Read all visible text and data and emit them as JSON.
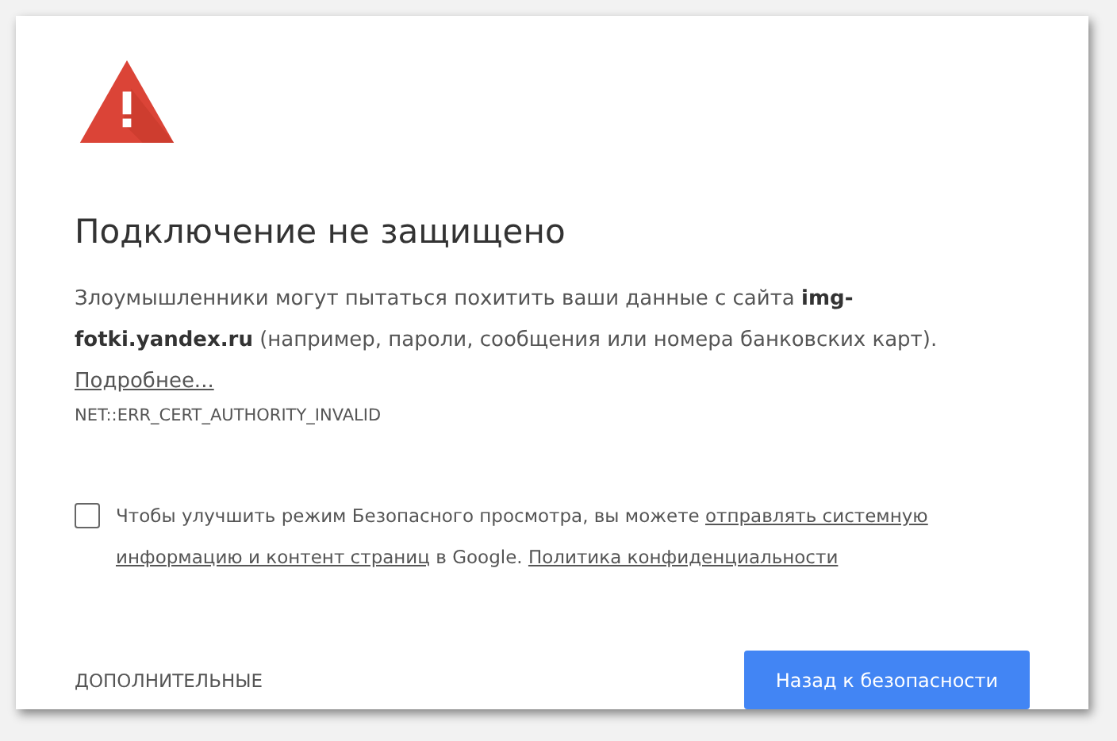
{
  "heading": "Подключение не защищено",
  "description": {
    "text": "Злоумышленники могут пытаться похитить ваши данные с сайта **img-fotki.yandex.ru** (например, пароли, сообщения или номера банковских карт).",
    "link": "Подробнее..."
  },
  "error_code": "NET::ERR_CERT_AUTHORITY_INVALID",
  "safe_browsing": {
    "checked": false,
    "parts": [
      {
        "kind": "text",
        "text": "Чтобы улучшить режим Безопасного просмотра, вы можете"
      },
      {
        "kind": "link",
        "text": "отправлять системную"
      },
      {
        "kind": "link",
        "text": "информацию и контент страниц"
      },
      {
        "kind": "text",
        "text": "в Google."
      },
      {
        "kind": "link",
        "text": "Политика конфиденциальности"
      }
    ]
  },
  "advanced_button": "ДОПОЛНИТЕЛЬНЫЕ",
  "back_button": "Назад к безопасности"
}
